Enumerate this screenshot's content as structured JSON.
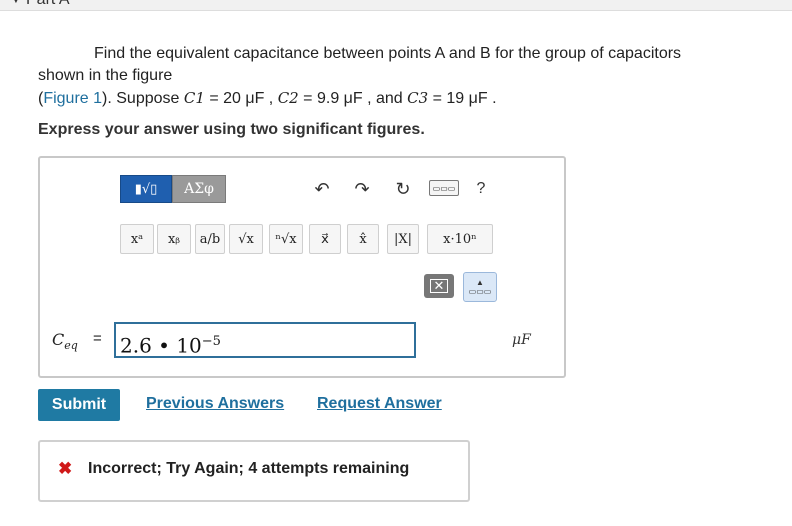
{
  "part": {
    "title": "Part A"
  },
  "problem": {
    "line1": "Find the equivalent capacitance between points A and B for the group of capacitors",
    "line2": "shown in the figure",
    "figure_link": "Figure 1",
    "text_suppose": "). Suppose ",
    "c1_sym": "C1",
    "c1_val": " = 20 μF , ",
    "c2_sym": "C2",
    "c2_val": " = 9.9 μF , and ",
    "c3_sym": "C3",
    "c3_val": " = 19 μF ."
  },
  "instruction": "Express your answer using two significant figures.",
  "toolbar": {
    "templates_tab": "▮√▯",
    "greek_tab": "ΑΣφ",
    "undo": "↶",
    "redo": "↷",
    "reset": "↻",
    "keyboard": "⌨",
    "help": "?"
  },
  "templates": [
    "xᵃ",
    "xᵦ",
    "a/b",
    "√x",
    "ⁿ√x",
    "x⃗",
    "x̂",
    "|X|",
    "x·10ⁿ"
  ],
  "answer": {
    "label": "C",
    "label_sub": "eq",
    "equals": "=",
    "value_base": "2.6 • 10",
    "value_exp": "−5",
    "unit": "μF"
  },
  "buttons": {
    "submit": "Submit",
    "previous_answers": "Previous Answers",
    "request_answer": "Request Answer"
  },
  "feedback": {
    "icon": "✖",
    "message": "Incorrect; Try Again; 4 attempts remaining"
  },
  "colors": {
    "link": "#1f6f9e",
    "submit_bg": "#1f7aa3",
    "error": "#d01919",
    "input_border": "#2f6f9a"
  }
}
